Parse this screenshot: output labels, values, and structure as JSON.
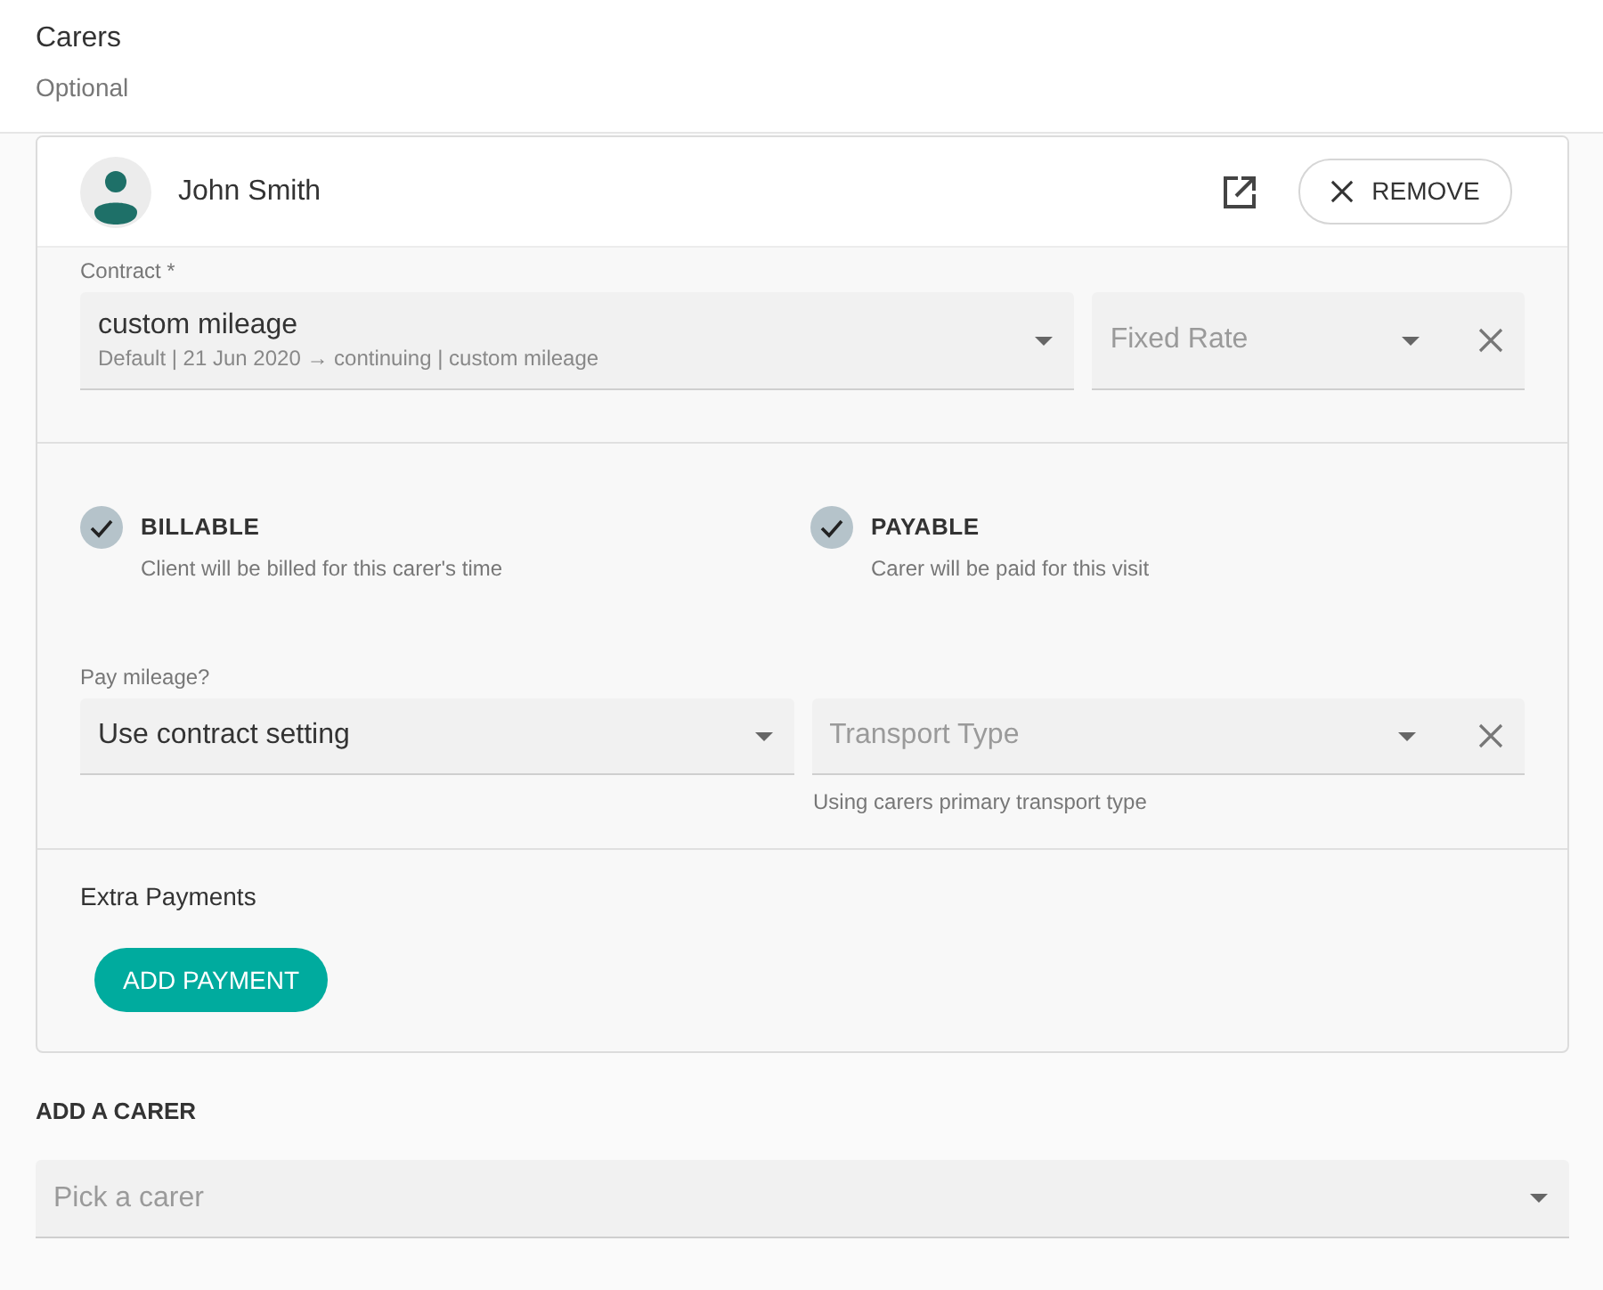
{
  "section": {
    "title": "Carers",
    "subtitle": "Optional"
  },
  "carers": [
    {
      "name": "John Smith",
      "remove_button": "REMOVE",
      "contract": {
        "label": "Contract *",
        "value": "custom mileage",
        "detail": "Default | 21 Jun 2020 → continuing | custom mileage"
      },
      "rate": {
        "placeholder": "Fixed Rate"
      },
      "options": [
        {
          "label": "BILLABLE",
          "description": "Client will be billed for this carer's time",
          "checked": true
        },
        {
          "label": "PAYABLE",
          "description": "Carer will be paid for this visit",
          "checked": true
        }
      ],
      "mileage": {
        "label": "Pay mileage?",
        "value": "Use contract setting"
      },
      "transport": {
        "placeholder": "Transport Type",
        "hint": "Using carers primary transport type"
      },
      "extra_payments": {
        "title": "Extra Payments",
        "button": "ADD PAYMENT"
      }
    }
  ],
  "add_carer": {
    "title": "ADD A CARER",
    "placeholder": "Pick a carer"
  }
}
